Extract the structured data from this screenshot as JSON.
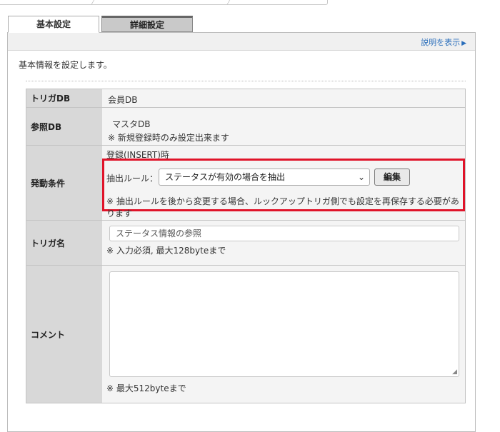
{
  "tabs": [
    {
      "label": "基本設定",
      "active": true
    },
    {
      "label": "詳細設定",
      "active": false
    }
  ],
  "help": {
    "label": "説明を表示",
    "arrow": "▶"
  },
  "intro": "基本情報を設定します。",
  "form": {
    "trigger_db": {
      "label": "トリガDB",
      "value": "会員DB"
    },
    "ref_db": {
      "label": "参照DB",
      "value": "マスタDB",
      "note": "※ 新規登録時のみ設定出来ます"
    },
    "condition": {
      "label": "発動条件",
      "timing": "登録(INSERT)時",
      "rule_label": "抽出ルール：",
      "rule_value": "ステータスが有効の場合を抽出",
      "edit_button": "編集",
      "note": "※ 抽出ルールを後から変更する場合、ルックアップトリガ側でも設定を再保存する必要があります"
    },
    "trigger_name": {
      "label": "トリガ名",
      "value": "ステータス情報の参照",
      "note": "※ 入力必須, 最大128byteまで"
    },
    "comment": {
      "label": "コメント",
      "value": "",
      "note": "※ 最大512byteまで"
    }
  },
  "colors": {
    "accent_red": "#e0142a",
    "note_red": "#d01818",
    "link_blue": "#2a6ebb"
  }
}
